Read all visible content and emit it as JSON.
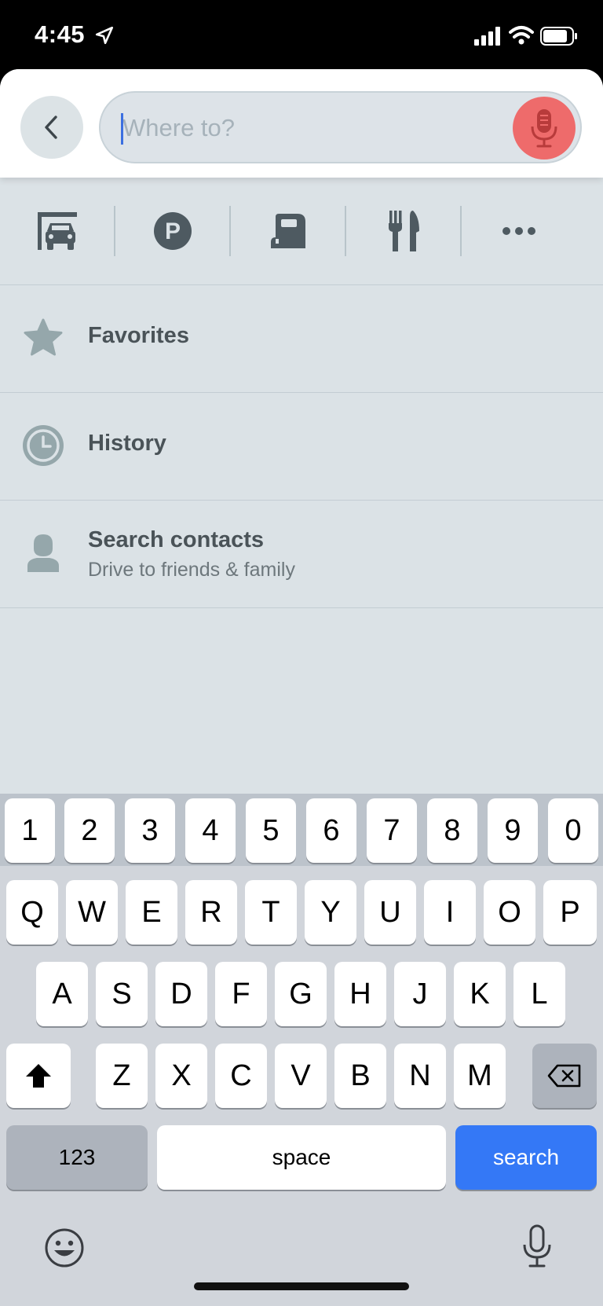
{
  "status": {
    "time": "4:45"
  },
  "search": {
    "placeholder": "Where to?"
  },
  "categories": [
    {
      "icon": "car-garage-icon"
    },
    {
      "icon": "parking-icon"
    },
    {
      "icon": "gas-station-icon"
    },
    {
      "icon": "restaurant-icon"
    },
    {
      "icon": "more-icon"
    }
  ],
  "list": {
    "favorites": {
      "title": "Favorites",
      "icon": "star-icon"
    },
    "history": {
      "title": "History",
      "icon": "clock-icon"
    },
    "contacts": {
      "title": "Search contacts",
      "subtitle": "Drive to friends & family",
      "icon": "person-icon"
    }
  },
  "keyboard": {
    "numbers": [
      "1",
      "2",
      "3",
      "4",
      "5",
      "6",
      "7",
      "8",
      "9",
      "0"
    ],
    "row1": [
      "Q",
      "W",
      "E",
      "R",
      "T",
      "Y",
      "U",
      "I",
      "O",
      "P"
    ],
    "row2": [
      "A",
      "S",
      "D",
      "F",
      "G",
      "H",
      "J",
      "K",
      "L"
    ],
    "row3": [
      "Z",
      "X",
      "C",
      "V",
      "B",
      "N",
      "M"
    ],
    "numbers_key": "123",
    "space_key": "space",
    "search_key": "search"
  },
  "colors": {
    "accent": "#3478f6",
    "mic": "#ee6b6b",
    "background": "#dbe2e6"
  }
}
